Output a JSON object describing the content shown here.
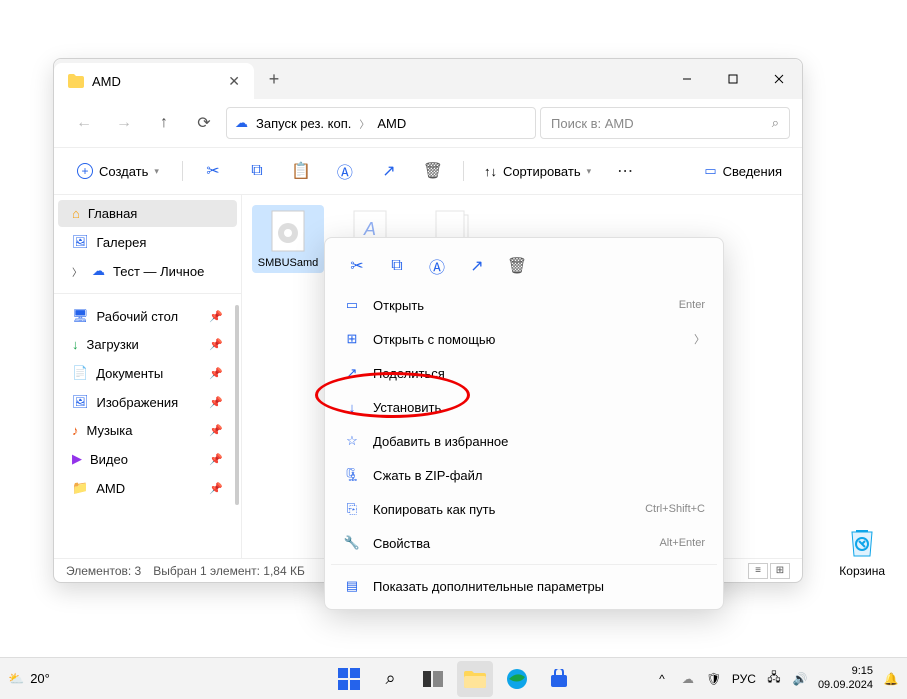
{
  "window": {
    "tab_title": "AMD",
    "breadcrumb": {
      "backup": "Запуск рез. коп.",
      "current": "AMD"
    },
    "search_placeholder": "Поиск в: AMD",
    "toolbar": {
      "create": "Создать",
      "sort": "Сортировать",
      "details": "Сведения"
    },
    "sidebar": {
      "home": "Главная",
      "gallery": "Галерея",
      "test_personal": "Тест — Личное",
      "desktop": "Рабочий стол",
      "downloads": "Загрузки",
      "documents": "Документы",
      "pictures": "Изображения",
      "music": "Музыка",
      "videos": "Видео",
      "amd": "AMD"
    },
    "files": {
      "selected": "SMBUSamd"
    },
    "status": {
      "elements": "Элементов: 3",
      "selected": "Выбран 1 элемент: 1,84 КБ"
    }
  },
  "context_menu": {
    "open": "Открыть",
    "open_hint": "Enter",
    "open_with": "Открыть с помощью",
    "share": "Поделиться",
    "install": "Установить",
    "favorite": "Добавить в избранное",
    "zip": "Сжать в ZIP-файл",
    "copy_path": "Копировать как путь",
    "copy_path_hint": "Ctrl+Shift+C",
    "properties": "Свойства",
    "properties_hint": "Alt+Enter",
    "more_options": "Показать дополнительные параметры"
  },
  "desktop": {
    "recycle_bin": "Корзина"
  },
  "taskbar": {
    "temp": "20°",
    "lang": "РУС",
    "time": "9:15",
    "date": "09.09.2024"
  }
}
